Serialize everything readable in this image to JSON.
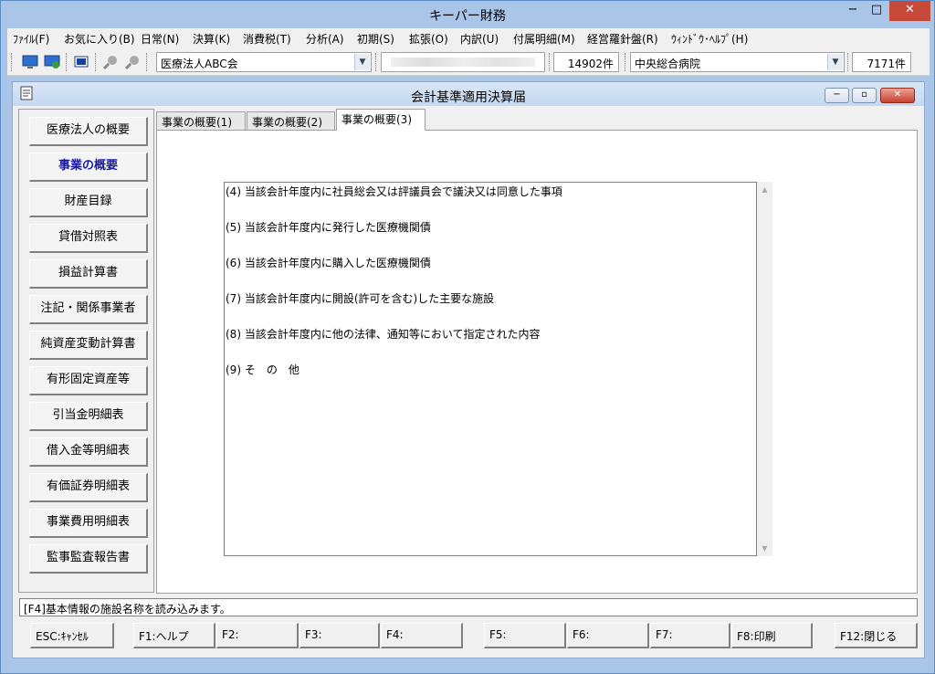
{
  "window": {
    "title": "キーパー財務",
    "minimize": "−",
    "maximize": "□",
    "close": "✕"
  },
  "menu": [
    "ﾌｧｲﾙ(F)",
    "お気に入り(B)",
    "日常(N)",
    "決算(K)",
    "消費税(T)",
    "分析(A)",
    "初期(S)",
    "拡張(O)",
    "内訳(U)",
    "付属明細(M)",
    "経営羅針盤(R)",
    "ｳｨﾝﾄﾞｳ･ﾍﾙﾌﾟ(H)"
  ],
  "toolbar": {
    "company_combo": "医療法人ABC会",
    "blurred_combo": "",
    "company_count": "14902件",
    "facility_combo": "中央総合病院",
    "facility_count": "7171件"
  },
  "child": {
    "title": "会計基準適用決算届",
    "minimize": "−",
    "restore": "▫",
    "close": "✕"
  },
  "sidebar": [
    {
      "label": "医療法人の概要",
      "active": false
    },
    {
      "label": "事業の概要",
      "active": true
    },
    {
      "label": "財産目録",
      "active": false
    },
    {
      "label": "貸借対照表",
      "active": false
    },
    {
      "label": "損益計算書",
      "active": false
    },
    {
      "label": "注記・関係事業者",
      "active": false
    },
    {
      "label": "純資産変動計算書",
      "active": false
    },
    {
      "label": "有形固定資産等",
      "active": false
    },
    {
      "label": "引当金明細表",
      "active": false
    },
    {
      "label": "借入金等明細表",
      "active": false
    },
    {
      "label": "有価証券明細表",
      "active": false
    },
    {
      "label": "事業費用明細表",
      "active": false
    },
    {
      "label": "監事監査報告書",
      "active": false
    }
  ],
  "tabs": [
    {
      "label": "事業の概要(1)",
      "active": false
    },
    {
      "label": "事業の概要(2)",
      "active": false
    },
    {
      "label": "事業の概要(3)",
      "active": true
    }
  ],
  "content_lines": [
    "(4) 当該会計年度内に社員総会又は評議員会で議決又は同意した事項",
    "(5) 当該会計年度内に発行した医療機関債",
    "(6) 当該会計年度内に購入した医療機関債",
    "(7) 当該会計年度内に開設(許可を含む)した主要な施設",
    "(8) 当該会計年度内に他の法律、通知等において指定された内容",
    "(9) そ　の　他"
  ],
  "status": "[F4]基本情報の施設名称を読み込みます。",
  "fkeys": [
    "ESC:ｷｬﾝｾﾙ",
    "F1:ヘルプ",
    "F2:",
    "F3:",
    "F4:",
    "F5:",
    "F6:",
    "F7:",
    "F8:印刷",
    "F12:閉じる"
  ]
}
